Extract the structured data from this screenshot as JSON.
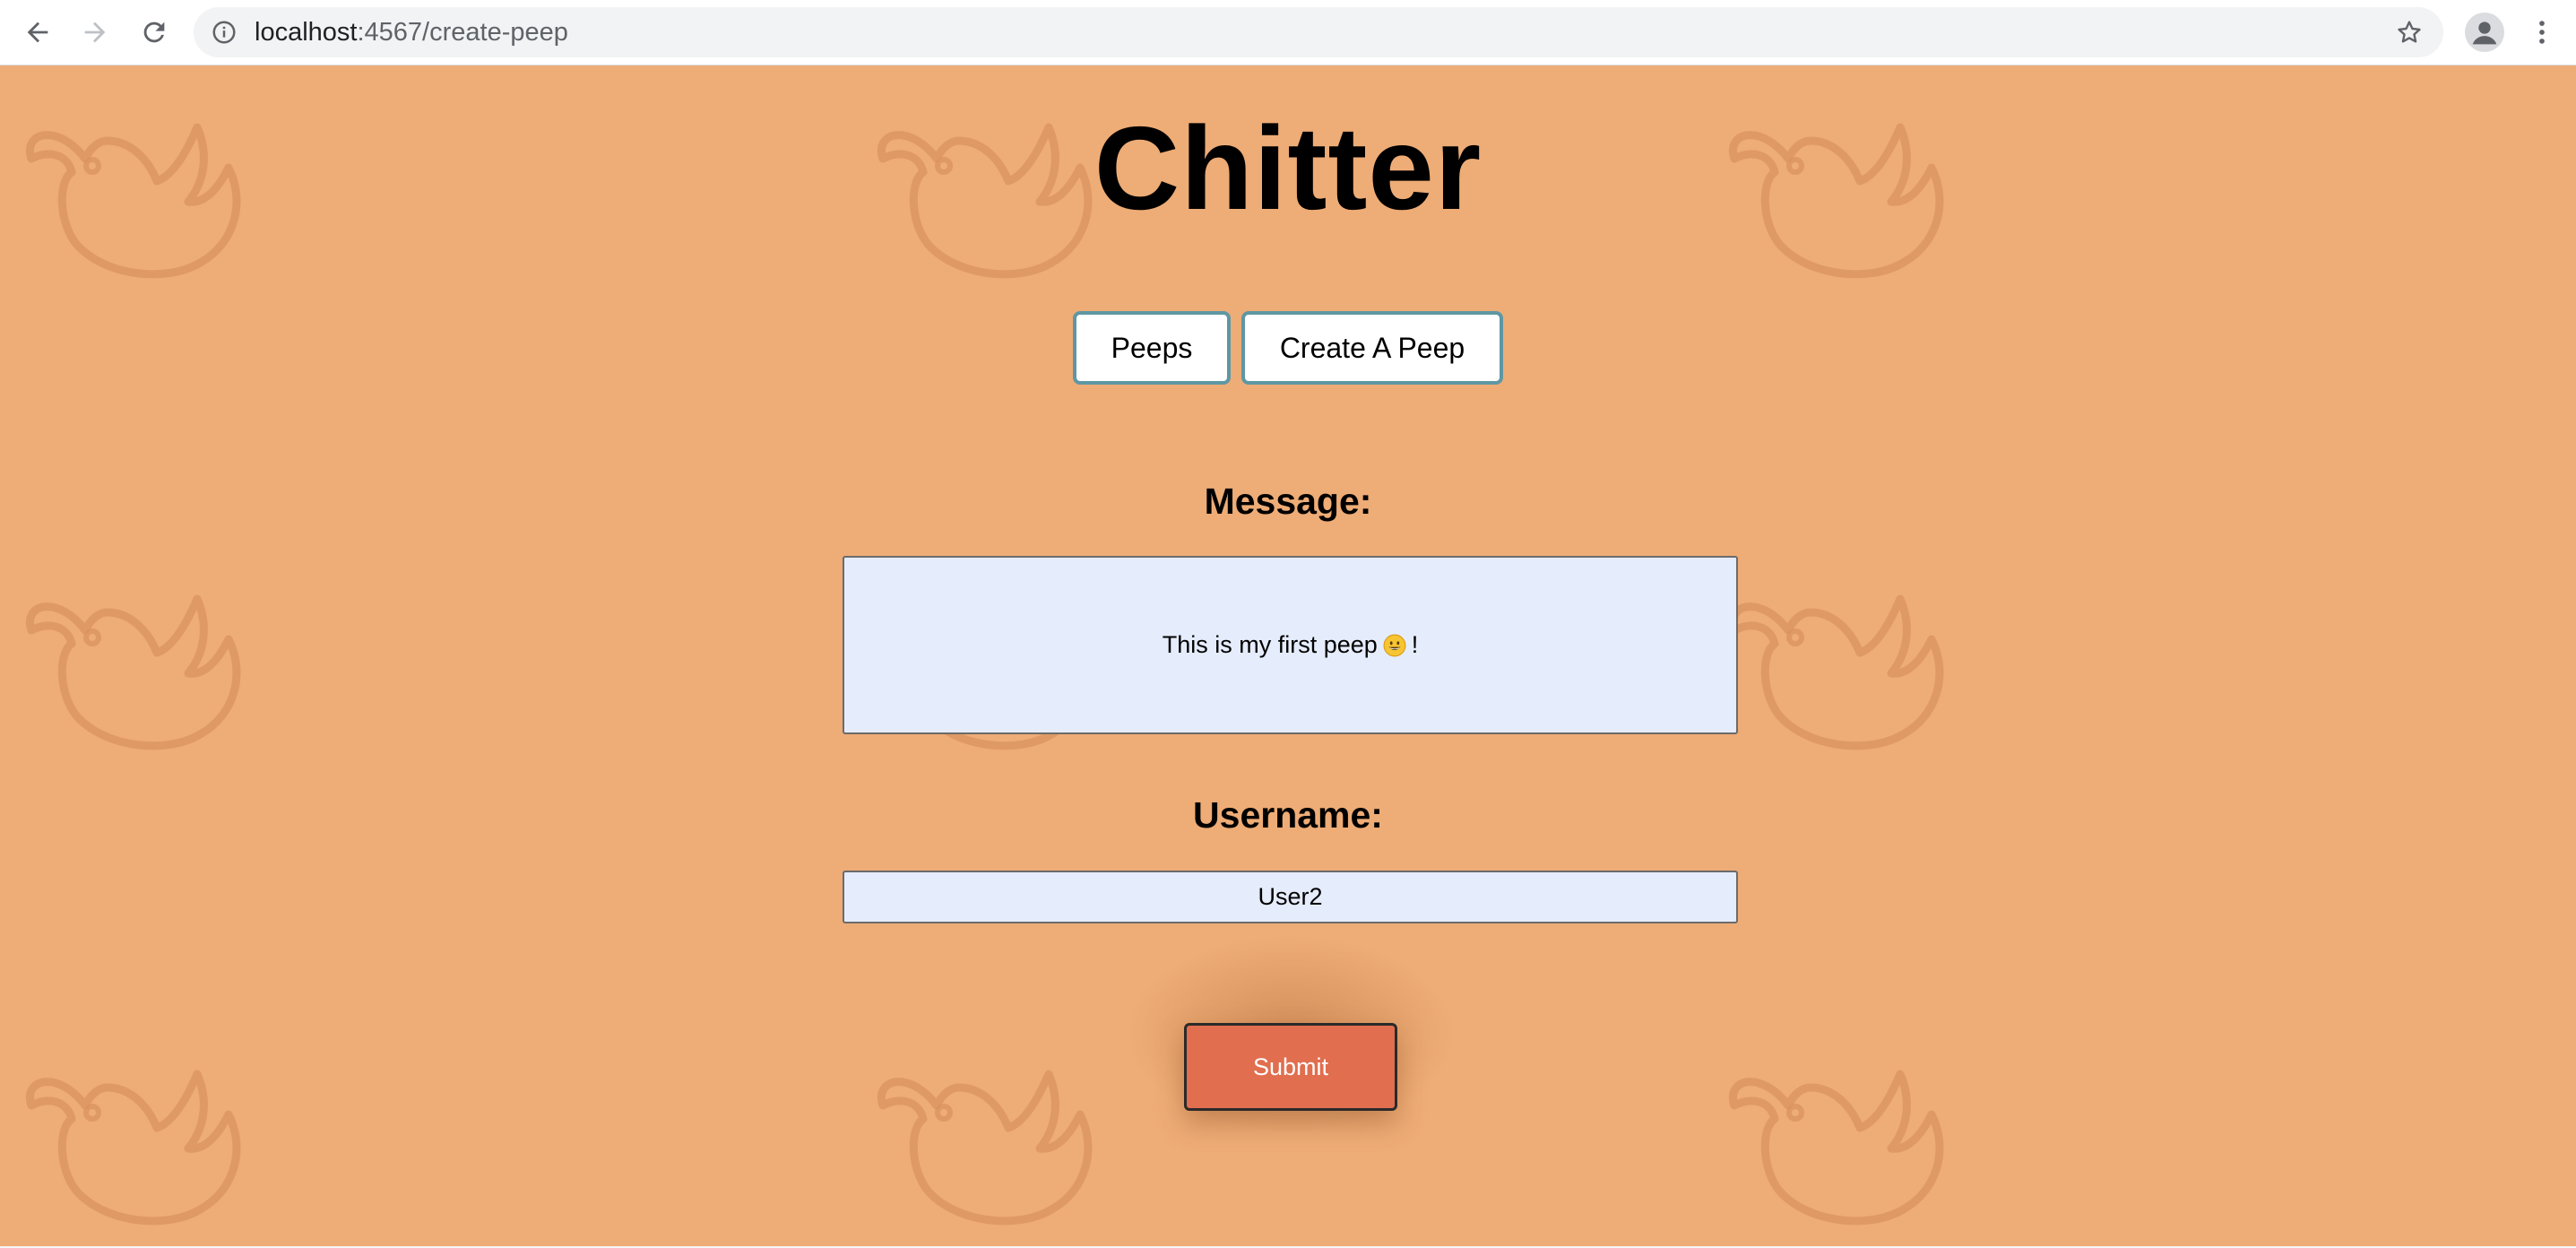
{
  "browser": {
    "url_host": "localhost",
    "url_path": ":4567/create-peep"
  },
  "app": {
    "title": "Chitter"
  },
  "nav": {
    "peeps_label": "Peeps",
    "create_label": "Create A Peep"
  },
  "form": {
    "message_label": "Message:",
    "message_text_before": "This is my first peep",
    "message_text_after": "!",
    "username_label": "Username:",
    "username_value": "User2",
    "submit_label": "Submit"
  },
  "colors": {
    "background": "#eeac76",
    "field_bg": "#e5ecfb",
    "nav_border": "#5e97a3",
    "submit_bg": "#e06e4f"
  }
}
